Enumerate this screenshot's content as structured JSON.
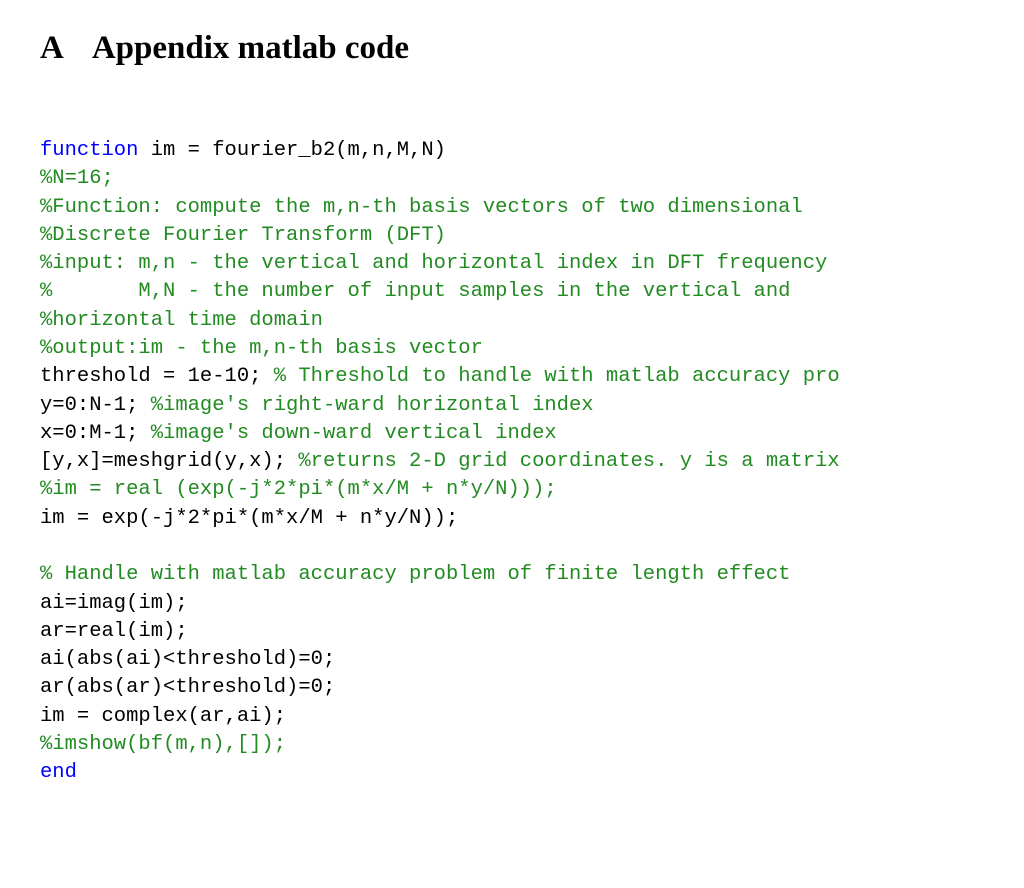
{
  "heading": {
    "label": "A",
    "title": "Appendix matlab code"
  },
  "code": {
    "lines": [
      {
        "segments": [
          {
            "cls": "kw",
            "t": "function"
          },
          {
            "cls": "pl",
            "t": " im = fourier_b2(m,n,M,N)"
          }
        ]
      },
      {
        "segments": [
          {
            "cls": "cm",
            "t": "%N=16;"
          }
        ]
      },
      {
        "segments": [
          {
            "cls": "cm",
            "t": "%Function: compute the m,n-th basis vectors of two dimensional"
          }
        ]
      },
      {
        "segments": [
          {
            "cls": "cm",
            "t": "%Discrete Fourier Transform (DFT)"
          }
        ]
      },
      {
        "segments": [
          {
            "cls": "cm",
            "t": "%input: m,n - the vertical and horizontal index in DFT frequency"
          }
        ]
      },
      {
        "segments": [
          {
            "cls": "cm",
            "t": "%       M,N - the number of input samples in the vertical and"
          }
        ]
      },
      {
        "segments": [
          {
            "cls": "cm",
            "t": "%horizontal time domain"
          }
        ]
      },
      {
        "segments": [
          {
            "cls": "cm",
            "t": "%output:im - the m,n-th basis vector"
          }
        ]
      },
      {
        "segments": [
          {
            "cls": "pl",
            "t": "threshold = 1e-10; "
          },
          {
            "cls": "cm",
            "t": "% Threshold to handle with matlab accuracy pro"
          }
        ]
      },
      {
        "segments": [
          {
            "cls": "pl",
            "t": "y=0:N-1; "
          },
          {
            "cls": "cm",
            "t": "%image's right-ward horizontal index"
          }
        ]
      },
      {
        "segments": [
          {
            "cls": "pl",
            "t": "x=0:M-1; "
          },
          {
            "cls": "cm",
            "t": "%image's down-ward vertical index"
          }
        ]
      },
      {
        "segments": [
          {
            "cls": "pl",
            "t": "[y,x]=meshgrid(y,x); "
          },
          {
            "cls": "cm",
            "t": "%returns 2-D grid coordinates. y is a matrix"
          }
        ]
      },
      {
        "segments": [
          {
            "cls": "cm",
            "t": "%im = real (exp(-j*2*pi*(m*x/M + n*y/N)));"
          }
        ]
      },
      {
        "segments": [
          {
            "cls": "pl",
            "t": "im = exp(-j*2*pi*(m*x/M + n*y/N));"
          }
        ]
      },
      {
        "segments": [
          {
            "cls": "pl",
            "t": " "
          }
        ]
      },
      {
        "segments": [
          {
            "cls": "cm",
            "t": "% Handle with matlab accuracy problem of finite length effect"
          }
        ]
      },
      {
        "segments": [
          {
            "cls": "pl",
            "t": "ai=imag(im);"
          }
        ]
      },
      {
        "segments": [
          {
            "cls": "pl",
            "t": "ar=real(im);"
          }
        ]
      },
      {
        "segments": [
          {
            "cls": "pl",
            "t": "ai(abs(ai)<threshold)=0;"
          }
        ]
      },
      {
        "segments": [
          {
            "cls": "pl",
            "t": "ar(abs(ar)<threshold)=0;"
          }
        ]
      },
      {
        "segments": [
          {
            "cls": "pl",
            "t": "im = complex(ar,ai);"
          }
        ]
      },
      {
        "segments": [
          {
            "cls": "cm",
            "t": "%imshow(bf(m,n),[]);"
          }
        ]
      },
      {
        "segments": [
          {
            "cls": "kw",
            "t": "end"
          }
        ]
      }
    ]
  }
}
